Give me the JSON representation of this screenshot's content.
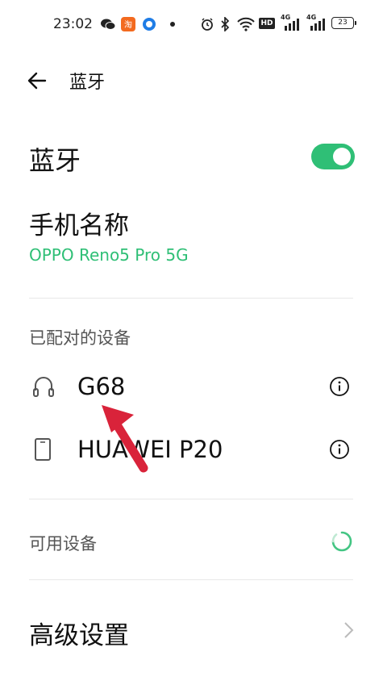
{
  "status_bar": {
    "time": "23:02",
    "hd_label": "HD",
    "signal1": "4G",
    "signal2": "4G",
    "battery": "23"
  },
  "header": {
    "title": "蓝牙"
  },
  "bluetooth": {
    "label": "蓝牙",
    "enabled": true,
    "toggle_color": "#2fbf76"
  },
  "phone_name": {
    "label": "手机名称",
    "value": "OPPO Reno5 Pro 5G"
  },
  "paired": {
    "header": "已配对的设备",
    "devices": [
      {
        "name": "G68",
        "icon": "headset-icon"
      },
      {
        "name": "HUAWEI P20",
        "icon": "phone-icon"
      }
    ]
  },
  "available": {
    "header": "可用设备",
    "icon": "loading-spinner-icon"
  },
  "advanced": {
    "label": "高级设置"
  },
  "colors": {
    "accent": "#2fbf76",
    "annotation_arrow": "#d9233a"
  }
}
